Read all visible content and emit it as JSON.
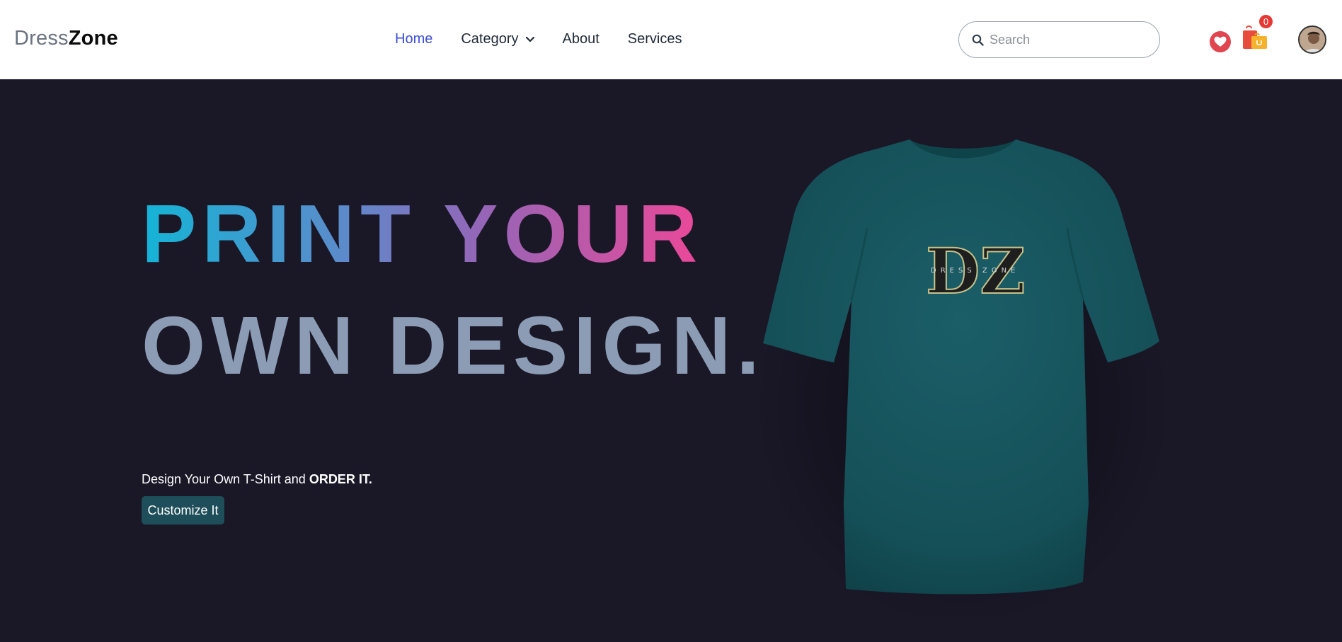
{
  "header": {
    "logo_light": "Dress",
    "logo_bold": "Zone",
    "nav": [
      {
        "label": "Home",
        "active": true
      },
      {
        "label": "Category",
        "has_dropdown": true
      },
      {
        "label": "About"
      },
      {
        "label": "Services"
      }
    ],
    "search_placeholder": "Search",
    "cart_count": "0",
    "icons": {
      "search": "search-icon",
      "wishlist": "heart-icon",
      "cart": "shopping-bag-icon",
      "user": "avatar"
    }
  },
  "hero": {
    "headline_line1": "PRINT YOUR",
    "headline_line2": "OWN DESIGN.",
    "tagline_prefix": "Design Your Own T-Shirt and ",
    "tagline_bold": "ORDER IT.",
    "cta_label": "Customize It",
    "shirt_logo_text": "DZ",
    "shirt_logo_subtext": "DRESS ZONE"
  },
  "colors": {
    "accent_nav": "#3b4fd6",
    "hero_bg": "#1a1727",
    "cta_bg": "#1d4e59",
    "shirt": "#17535c",
    "badge": "#e53935",
    "heart": "#e1454f"
  }
}
